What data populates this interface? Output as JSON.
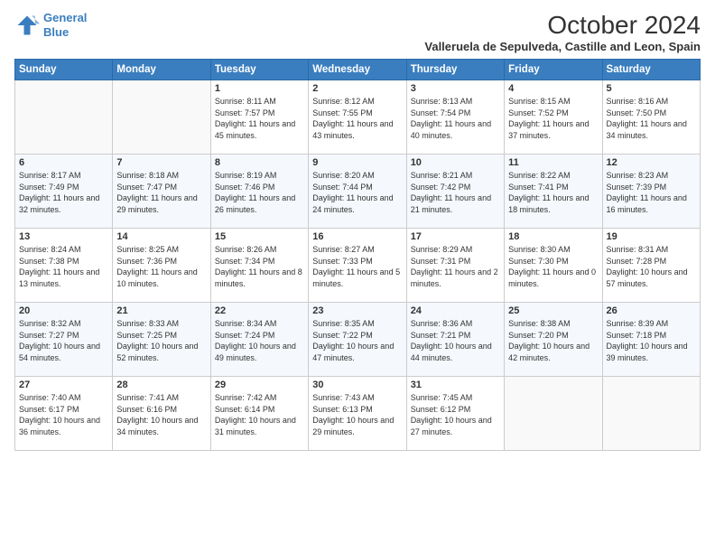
{
  "logo": {
    "line1": "General",
    "line2": "Blue"
  },
  "title": "October 2024",
  "subtitle": "Valleruela de Sepulveda, Castille and Leon, Spain",
  "days_of_week": [
    "Sunday",
    "Monday",
    "Tuesday",
    "Wednesday",
    "Thursday",
    "Friday",
    "Saturday"
  ],
  "weeks": [
    [
      {
        "day": "",
        "sunrise": "",
        "sunset": "",
        "daylight": ""
      },
      {
        "day": "",
        "sunrise": "",
        "sunset": "",
        "daylight": ""
      },
      {
        "day": "1",
        "sunrise": "Sunrise: 8:11 AM",
        "sunset": "Sunset: 7:57 PM",
        "daylight": "Daylight: 11 hours and 45 minutes."
      },
      {
        "day": "2",
        "sunrise": "Sunrise: 8:12 AM",
        "sunset": "Sunset: 7:55 PM",
        "daylight": "Daylight: 11 hours and 43 minutes."
      },
      {
        "day": "3",
        "sunrise": "Sunrise: 8:13 AM",
        "sunset": "Sunset: 7:54 PM",
        "daylight": "Daylight: 11 hours and 40 minutes."
      },
      {
        "day": "4",
        "sunrise": "Sunrise: 8:15 AM",
        "sunset": "Sunset: 7:52 PM",
        "daylight": "Daylight: 11 hours and 37 minutes."
      },
      {
        "day": "5",
        "sunrise": "Sunrise: 8:16 AM",
        "sunset": "Sunset: 7:50 PM",
        "daylight": "Daylight: 11 hours and 34 minutes."
      }
    ],
    [
      {
        "day": "6",
        "sunrise": "Sunrise: 8:17 AM",
        "sunset": "Sunset: 7:49 PM",
        "daylight": "Daylight: 11 hours and 32 minutes."
      },
      {
        "day": "7",
        "sunrise": "Sunrise: 8:18 AM",
        "sunset": "Sunset: 7:47 PM",
        "daylight": "Daylight: 11 hours and 29 minutes."
      },
      {
        "day": "8",
        "sunrise": "Sunrise: 8:19 AM",
        "sunset": "Sunset: 7:46 PM",
        "daylight": "Daylight: 11 hours and 26 minutes."
      },
      {
        "day": "9",
        "sunrise": "Sunrise: 8:20 AM",
        "sunset": "Sunset: 7:44 PM",
        "daylight": "Daylight: 11 hours and 24 minutes."
      },
      {
        "day": "10",
        "sunrise": "Sunrise: 8:21 AM",
        "sunset": "Sunset: 7:42 PM",
        "daylight": "Daylight: 11 hours and 21 minutes."
      },
      {
        "day": "11",
        "sunrise": "Sunrise: 8:22 AM",
        "sunset": "Sunset: 7:41 PM",
        "daylight": "Daylight: 11 hours and 18 minutes."
      },
      {
        "day": "12",
        "sunrise": "Sunrise: 8:23 AM",
        "sunset": "Sunset: 7:39 PM",
        "daylight": "Daylight: 11 hours and 16 minutes."
      }
    ],
    [
      {
        "day": "13",
        "sunrise": "Sunrise: 8:24 AM",
        "sunset": "Sunset: 7:38 PM",
        "daylight": "Daylight: 11 hours and 13 minutes."
      },
      {
        "day": "14",
        "sunrise": "Sunrise: 8:25 AM",
        "sunset": "Sunset: 7:36 PM",
        "daylight": "Daylight: 11 hours and 10 minutes."
      },
      {
        "day": "15",
        "sunrise": "Sunrise: 8:26 AM",
        "sunset": "Sunset: 7:34 PM",
        "daylight": "Daylight: 11 hours and 8 minutes."
      },
      {
        "day": "16",
        "sunrise": "Sunrise: 8:27 AM",
        "sunset": "Sunset: 7:33 PM",
        "daylight": "Daylight: 11 hours and 5 minutes."
      },
      {
        "day": "17",
        "sunrise": "Sunrise: 8:29 AM",
        "sunset": "Sunset: 7:31 PM",
        "daylight": "Daylight: 11 hours and 2 minutes."
      },
      {
        "day": "18",
        "sunrise": "Sunrise: 8:30 AM",
        "sunset": "Sunset: 7:30 PM",
        "daylight": "Daylight: 11 hours and 0 minutes."
      },
      {
        "day": "19",
        "sunrise": "Sunrise: 8:31 AM",
        "sunset": "Sunset: 7:28 PM",
        "daylight": "Daylight: 10 hours and 57 minutes."
      }
    ],
    [
      {
        "day": "20",
        "sunrise": "Sunrise: 8:32 AM",
        "sunset": "Sunset: 7:27 PM",
        "daylight": "Daylight: 10 hours and 54 minutes."
      },
      {
        "day": "21",
        "sunrise": "Sunrise: 8:33 AM",
        "sunset": "Sunset: 7:25 PM",
        "daylight": "Daylight: 10 hours and 52 minutes."
      },
      {
        "day": "22",
        "sunrise": "Sunrise: 8:34 AM",
        "sunset": "Sunset: 7:24 PM",
        "daylight": "Daylight: 10 hours and 49 minutes."
      },
      {
        "day": "23",
        "sunrise": "Sunrise: 8:35 AM",
        "sunset": "Sunset: 7:22 PM",
        "daylight": "Daylight: 10 hours and 47 minutes."
      },
      {
        "day": "24",
        "sunrise": "Sunrise: 8:36 AM",
        "sunset": "Sunset: 7:21 PM",
        "daylight": "Daylight: 10 hours and 44 minutes."
      },
      {
        "day": "25",
        "sunrise": "Sunrise: 8:38 AM",
        "sunset": "Sunset: 7:20 PM",
        "daylight": "Daylight: 10 hours and 42 minutes."
      },
      {
        "day": "26",
        "sunrise": "Sunrise: 8:39 AM",
        "sunset": "Sunset: 7:18 PM",
        "daylight": "Daylight: 10 hours and 39 minutes."
      }
    ],
    [
      {
        "day": "27",
        "sunrise": "Sunrise: 7:40 AM",
        "sunset": "Sunset: 6:17 PM",
        "daylight": "Daylight: 10 hours and 36 minutes."
      },
      {
        "day": "28",
        "sunrise": "Sunrise: 7:41 AM",
        "sunset": "Sunset: 6:16 PM",
        "daylight": "Daylight: 10 hours and 34 minutes."
      },
      {
        "day": "29",
        "sunrise": "Sunrise: 7:42 AM",
        "sunset": "Sunset: 6:14 PM",
        "daylight": "Daylight: 10 hours and 31 minutes."
      },
      {
        "day": "30",
        "sunrise": "Sunrise: 7:43 AM",
        "sunset": "Sunset: 6:13 PM",
        "daylight": "Daylight: 10 hours and 29 minutes."
      },
      {
        "day": "31",
        "sunrise": "Sunrise: 7:45 AM",
        "sunset": "Sunset: 6:12 PM",
        "daylight": "Daylight: 10 hours and 27 minutes."
      },
      {
        "day": "",
        "sunrise": "",
        "sunset": "",
        "daylight": ""
      },
      {
        "day": "",
        "sunrise": "",
        "sunset": "",
        "daylight": ""
      }
    ]
  ]
}
